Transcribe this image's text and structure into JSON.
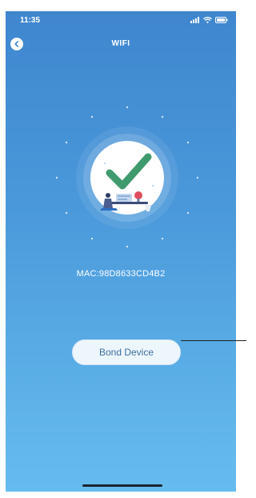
{
  "status_bar": {
    "time": "11:35",
    "icons": [
      "signal-icon",
      "wifi-icon",
      "battery-icon"
    ]
  },
  "nav": {
    "back_icon": "chevron-left-icon",
    "title": "WIFI"
  },
  "illustration": {
    "icon": "success-checkmark-icon",
    "checkmark_color": "#3f9a6d"
  },
  "device": {
    "mac": "MAC:98D8633CD4B2"
  },
  "actions": {
    "bond_label": "Bond Device"
  },
  "colors": {
    "background_top": "#3f86cf",
    "background_bottom": "#66bcee",
    "button_text": "#3c6f9e"
  }
}
